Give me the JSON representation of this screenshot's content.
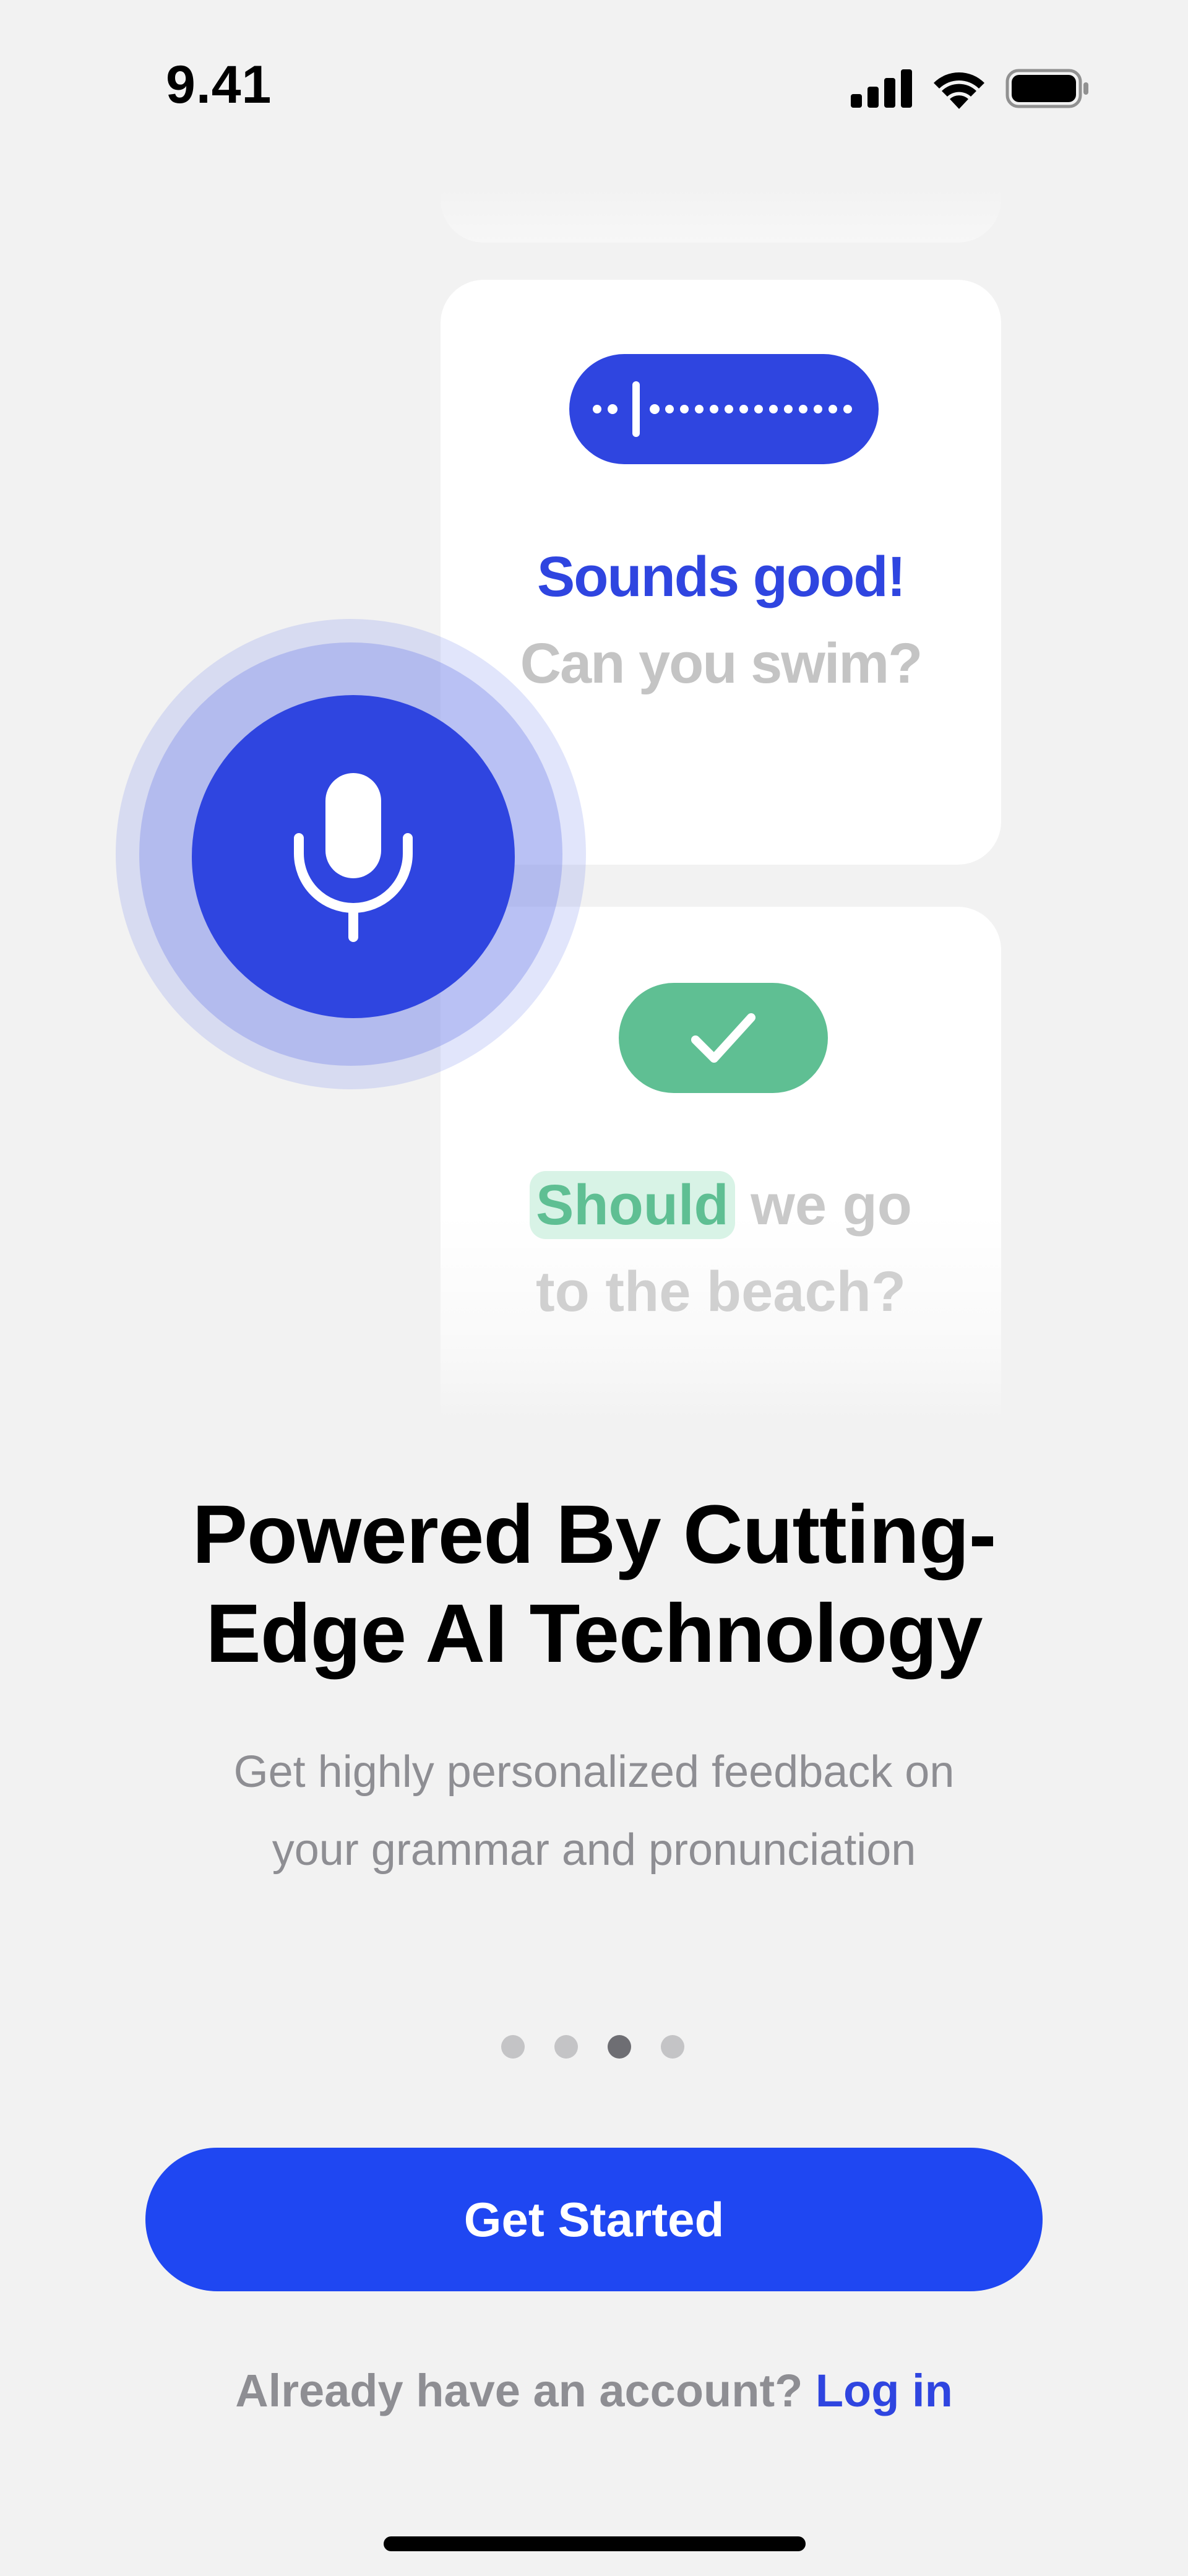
{
  "status_bar": {
    "time": "9.41",
    "icons": [
      "signal-icon",
      "wifi-icon",
      "battery-icon"
    ]
  },
  "illustration": {
    "card1": {
      "highlight_text": "Sounds good!",
      "secondary_text": "Can you swim?",
      "icon": "audio-wave-icon"
    },
    "card2": {
      "highlight_word": "Should",
      "rest_line1": " we go",
      "line2": "to the beach?",
      "icon": "checkmark-icon"
    },
    "mic_icon": "microphone-icon"
  },
  "onboarding": {
    "title_line1": "Powered By Cutting-",
    "title_line2": "Edge AI Technology",
    "subtitle_line1": "Get highly personalized feedback on",
    "subtitle_line2": "your grammar and pronunciation",
    "page_count": 4,
    "active_page": 3
  },
  "actions": {
    "primary_label": "Get Started",
    "account_prompt": "Already have an account?",
    "login_label": "Log in"
  },
  "colors": {
    "brand_blue": "#1f47f2",
    "accent_blue": "#2f45e0",
    "success_green": "#5fbf93",
    "background": "#f2f2f2"
  }
}
